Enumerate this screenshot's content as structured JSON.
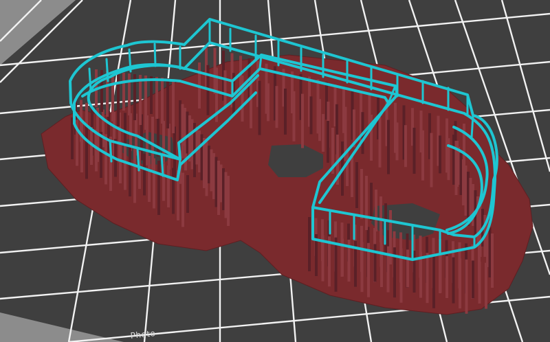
{
  "viewport": {
    "printer_label": "Photo",
    "colors": {
      "background": "#8c8c8c",
      "build_plate": "#3f3f3f",
      "grid_line": "#f2f2f2",
      "raft": "#7a2a2d",
      "raft_edge": "#5e1f22",
      "support": "#8c3a40",
      "support_dark": "#5a2027",
      "model_outline": "#1ec6d2"
    },
    "scene_objects": [
      "build-plate",
      "raft-layer",
      "support-structures",
      "model-outline"
    ]
  }
}
